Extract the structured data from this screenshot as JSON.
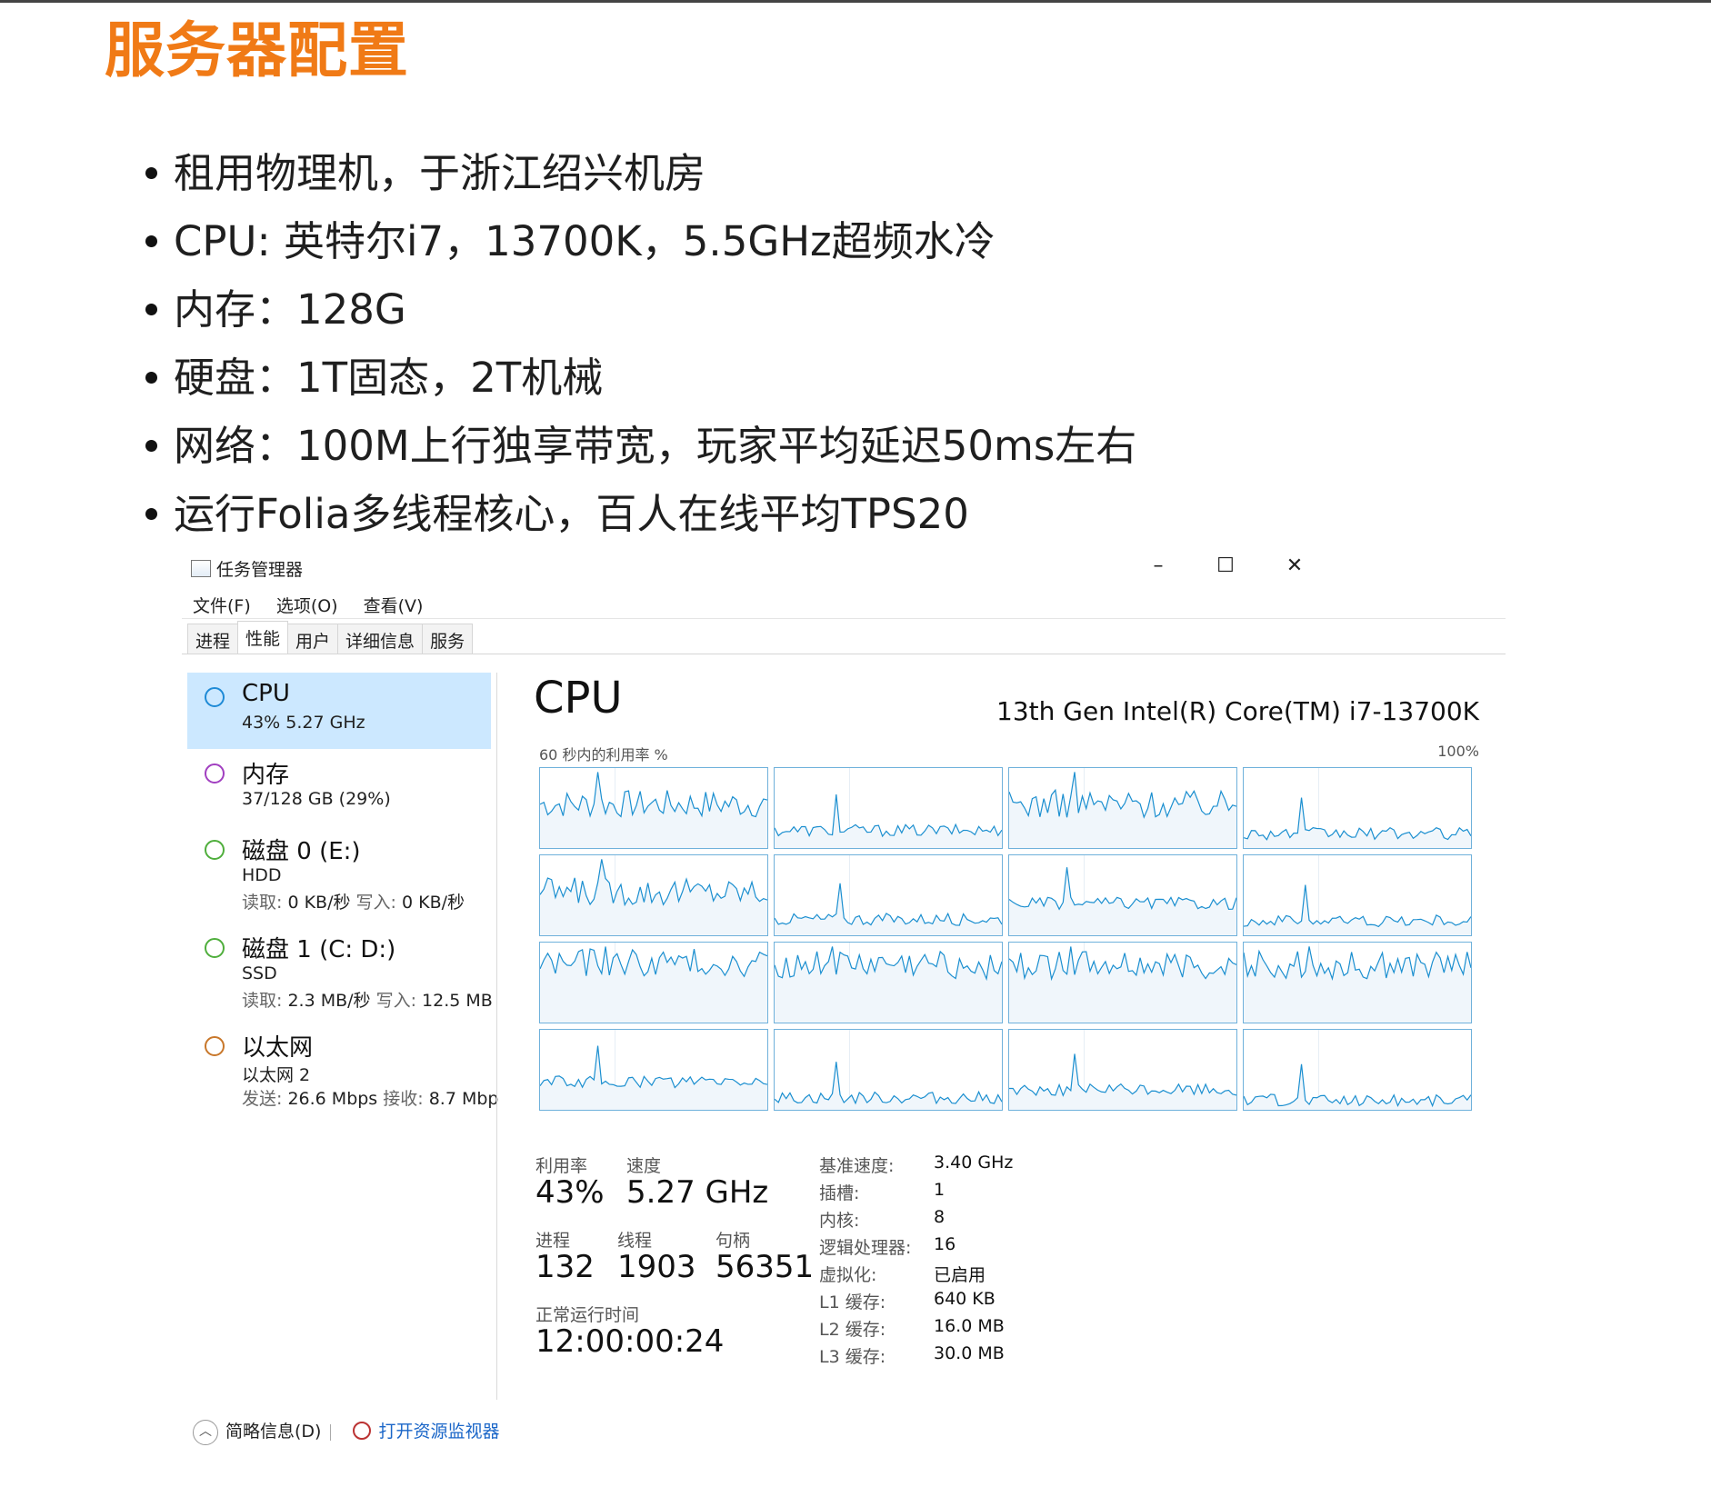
{
  "slide": {
    "title": "服务器配置",
    "bullets": [
      "租用物理机，于浙江绍兴机房",
      "CPU: 英特尔i7，13700K，5.5GHz超频水冷",
      "内存：128G",
      "硬盘：1T固态，2T机械",
      "网络：100M上行独享带宽，玩家平均延迟50ms左右",
      "运行Folia多线程核心，百人在线平均TPS20"
    ]
  },
  "taskmgr": {
    "window_title": "任务管理器",
    "window_controls": {
      "minimize": "–",
      "maximize": "☐",
      "close": "✕"
    },
    "menu": [
      "文件(F)",
      "选项(O)",
      "查看(V)"
    ],
    "tabs": [
      "进程",
      "性能",
      "用户",
      "详细信息",
      "服务"
    ],
    "active_tab": "性能",
    "resources": [
      {
        "name": "CPU",
        "line1": "43%  5.27 GHz",
        "color": "#1e8ad6",
        "selected": true
      },
      {
        "name": "内存",
        "line1": "37/128 GB (29%)",
        "color": "#a13fc0"
      },
      {
        "name": "磁盘 0 (E:)",
        "line1": "HDD",
        "read_label": "读取:",
        "read": "0 KB/秒",
        "write_label": "写入:",
        "write": "0 KB/秒",
        "color": "#4fae3c"
      },
      {
        "name": "磁盘 1 (C: D:)",
        "line1": "SSD",
        "read_label": "读取:",
        "read": "2.3 MB/秒",
        "write_label": "写入:",
        "write": "12.5 MB",
        "color": "#4fae3c"
      },
      {
        "name": "以太网",
        "line1": "以太网 2",
        "read_label": "发送:",
        "read": "26.6 Mbps",
        "write_label": "接收:",
        "write": "8.7 Mbp",
        "color": "#c8772a"
      }
    ],
    "cpu_panel": {
      "title": "CPU",
      "model": "13th Gen Intel(R) Core(TM) i7-13700K",
      "axis_left": "60 秒内的利用率 %",
      "axis_right": "100%",
      "graph_line_color": "#1b8fd0",
      "graph_fill_color": "#f0f6fb",
      "stats": {
        "util_label": "利用率",
        "util_value": "43%",
        "speed_label": "速度",
        "speed_value": "5.27 GHz",
        "proc_label": "进程",
        "proc_value": "132",
        "thread_label": "线程",
        "thread_value": "1903",
        "handle_label": "句柄",
        "handle_value": "56351",
        "uptime_label": "正常运行时间",
        "uptime_value": "12:00:00:24"
      },
      "info": [
        {
          "k": "基准速度:",
          "v": "3.40 GHz"
        },
        {
          "k": "插槽:",
          "v": "1"
        },
        {
          "k": "内核:",
          "v": "8"
        },
        {
          "k": "逻辑处理器:",
          "v": "16"
        },
        {
          "k": "虚拟化:",
          "v": "已启用"
        },
        {
          "k": "L1 缓存:",
          "v": "640 KB"
        },
        {
          "k": "L2 缓存:",
          "v": "16.0 MB"
        },
        {
          "k": "L3 缓存:",
          "v": "30.0 MB"
        }
      ]
    },
    "footer": {
      "brief": "简略信息(D)",
      "monitor": "打开资源监视器"
    }
  }
}
